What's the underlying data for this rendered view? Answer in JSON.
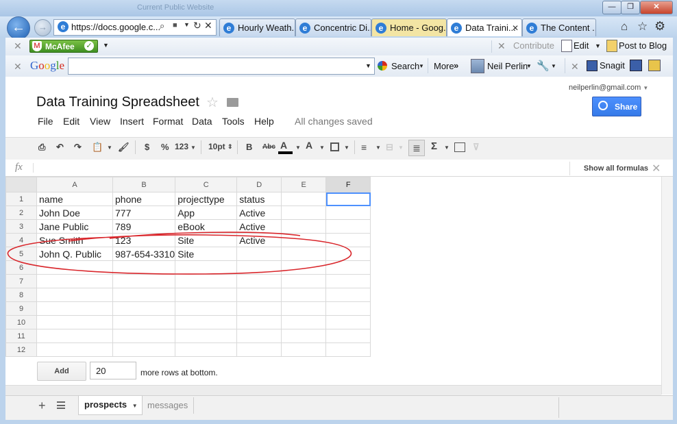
{
  "window": {
    "title_blur": "Current Public Website"
  },
  "window_buttons": {
    "minimize": "—",
    "restore": "❐",
    "close": "✕"
  },
  "browser": {
    "address": "https://docs.google.c...",
    "tabs": [
      {
        "label": "Hourly Weath...",
        "state": "normal"
      },
      {
        "label": "Concentric Di...",
        "state": "normal"
      },
      {
        "label": "Home - Goog...",
        "state": "highlighted"
      },
      {
        "label": "Data Traini...",
        "state": "active"
      },
      {
        "label": "The Content ...",
        "state": "normal"
      }
    ],
    "toolbar1": {
      "mcafee": "McAfee",
      "contribute": "Contribute",
      "edit": "Edit",
      "post_to_blog": "Post to Blog"
    },
    "toolbar2": {
      "google": "Google",
      "search": "Search",
      "more": "More",
      "user": "Neil Perlin",
      "snagit": "Snagit"
    }
  },
  "doc": {
    "title": "Data Training Spreadsheet",
    "user_email": "neilperlin@gmail.com",
    "share_label": "Share",
    "save_status": "All changes saved",
    "menus": [
      "File",
      "Edit",
      "View",
      "Insert",
      "Format",
      "Data",
      "Tools",
      "Help"
    ],
    "toolbar": {
      "currency": "$",
      "percent": "%",
      "number_format": "123",
      "font_size": "10pt",
      "bold": "B",
      "strike": "Abc",
      "text_color": "A",
      "fill_color": "A",
      "sigma": "Σ"
    },
    "formula_bar": {
      "fx": "fx",
      "show_all": "Show all formulas"
    }
  },
  "sheet": {
    "columns": [
      "A",
      "B",
      "C",
      "D",
      "E",
      "F"
    ],
    "selected_column": "F",
    "rows": [
      {
        "num": "1",
        "cells": [
          "name",
          "phone",
          "projecttype",
          "status",
          "",
          ""
        ]
      },
      {
        "num": "2",
        "cells": [
          "John Doe",
          "777",
          "App",
          "Active",
          "",
          ""
        ]
      },
      {
        "num": "3",
        "cells": [
          "Jane Public",
          "789",
          "eBook",
          "Active",
          "",
          ""
        ]
      },
      {
        "num": "4",
        "cells": [
          "Sue Smith",
          "123",
          "Site",
          "Active",
          "",
          ""
        ]
      },
      {
        "num": "5",
        "cells": [
          "John Q. Public",
          "987-654-3310",
          "Site",
          "",
          "",
          ""
        ]
      },
      {
        "num": "6",
        "cells": [
          "",
          "",
          "",
          "",
          "",
          ""
        ]
      },
      {
        "num": "7",
        "cells": [
          "",
          "",
          "",
          "",
          "",
          ""
        ]
      },
      {
        "num": "8",
        "cells": [
          "",
          "",
          "",
          "",
          "",
          ""
        ]
      },
      {
        "num": "9",
        "cells": [
          "",
          "",
          "",
          "",
          "",
          ""
        ]
      },
      {
        "num": "10",
        "cells": [
          "",
          "",
          "",
          "",
          "",
          ""
        ]
      },
      {
        "num": "11",
        "cells": [
          "",
          "",
          "",
          "",
          "",
          ""
        ]
      },
      {
        "num": "12",
        "cells": [
          "",
          "",
          "",
          "",
          "",
          ""
        ]
      }
    ],
    "add_button": "Add",
    "add_rows_value": "20",
    "add_rows_suffix": "more rows at bottom.",
    "sheet_tabs": [
      {
        "label": "prospects",
        "active": true
      },
      {
        "label": "messages",
        "active": false
      }
    ]
  },
  "annotation": {
    "color": "#d9262b"
  }
}
